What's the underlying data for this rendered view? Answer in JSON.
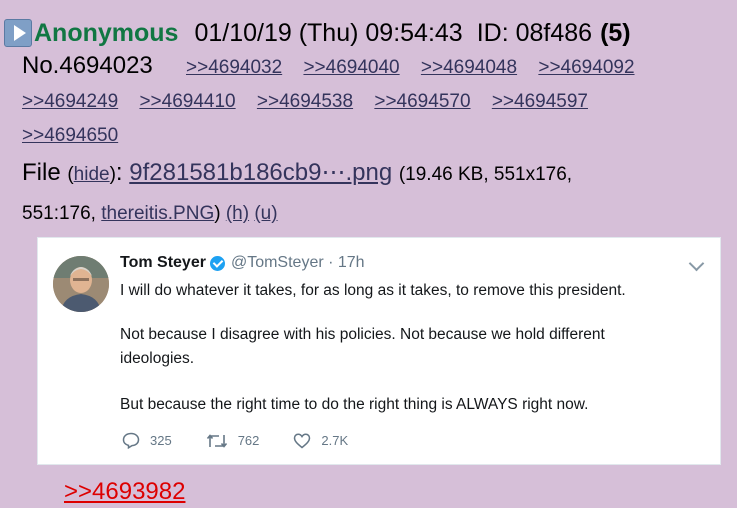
{
  "post": {
    "name": "Anonymous",
    "datetime": "01/10/19 (Thu) 09:54:43",
    "id": "ID: 08f486",
    "reply_count": "(5)",
    "number": "No.4694023",
    "backlinks_row1": [
      ">>4694032",
      ">>4694040",
      ">>4694048",
      ">>4694092"
    ],
    "backlinks_row2": [
      ">>4694249",
      ">>4694410",
      ">>4694538",
      ">>4694570",
      ">>4694597"
    ],
    "backlinks_row3": [
      ">>4694650"
    ],
    "file": {
      "label": "File",
      "hide": "hide",
      "filename": "9f281581b186cb9⋯.png",
      "meta1": "(19.46 KB, 551x176,",
      "meta2": "551:176,",
      "original_name": "thereitis.PNG",
      "h": "(h)",
      "u": "(u)"
    },
    "quote": ">>4693982"
  },
  "tweet": {
    "name": "Tom Steyer",
    "handle": "@TomSteyer · 17h",
    "line1": "I will do whatever it takes, for as long as it takes, to remove this president.",
    "line2": "Not because I disagree with his policies. Not because we hold different",
    "line3": "ideologies.",
    "line4": "But because the right time to do the right thing is ALWAYS right now.",
    "replies": "325",
    "retweets": "762",
    "likes": "2.7K"
  },
  "colors": {
    "background": "#d6bfd8",
    "name": "#117743",
    "link": "#34345c",
    "quote": "#dd0000",
    "verified": "#1da1f2"
  },
  "icons": [
    "expand-icon",
    "verified-icon",
    "chevron-down-icon",
    "reply-icon",
    "retweet-icon",
    "like-icon"
  ]
}
